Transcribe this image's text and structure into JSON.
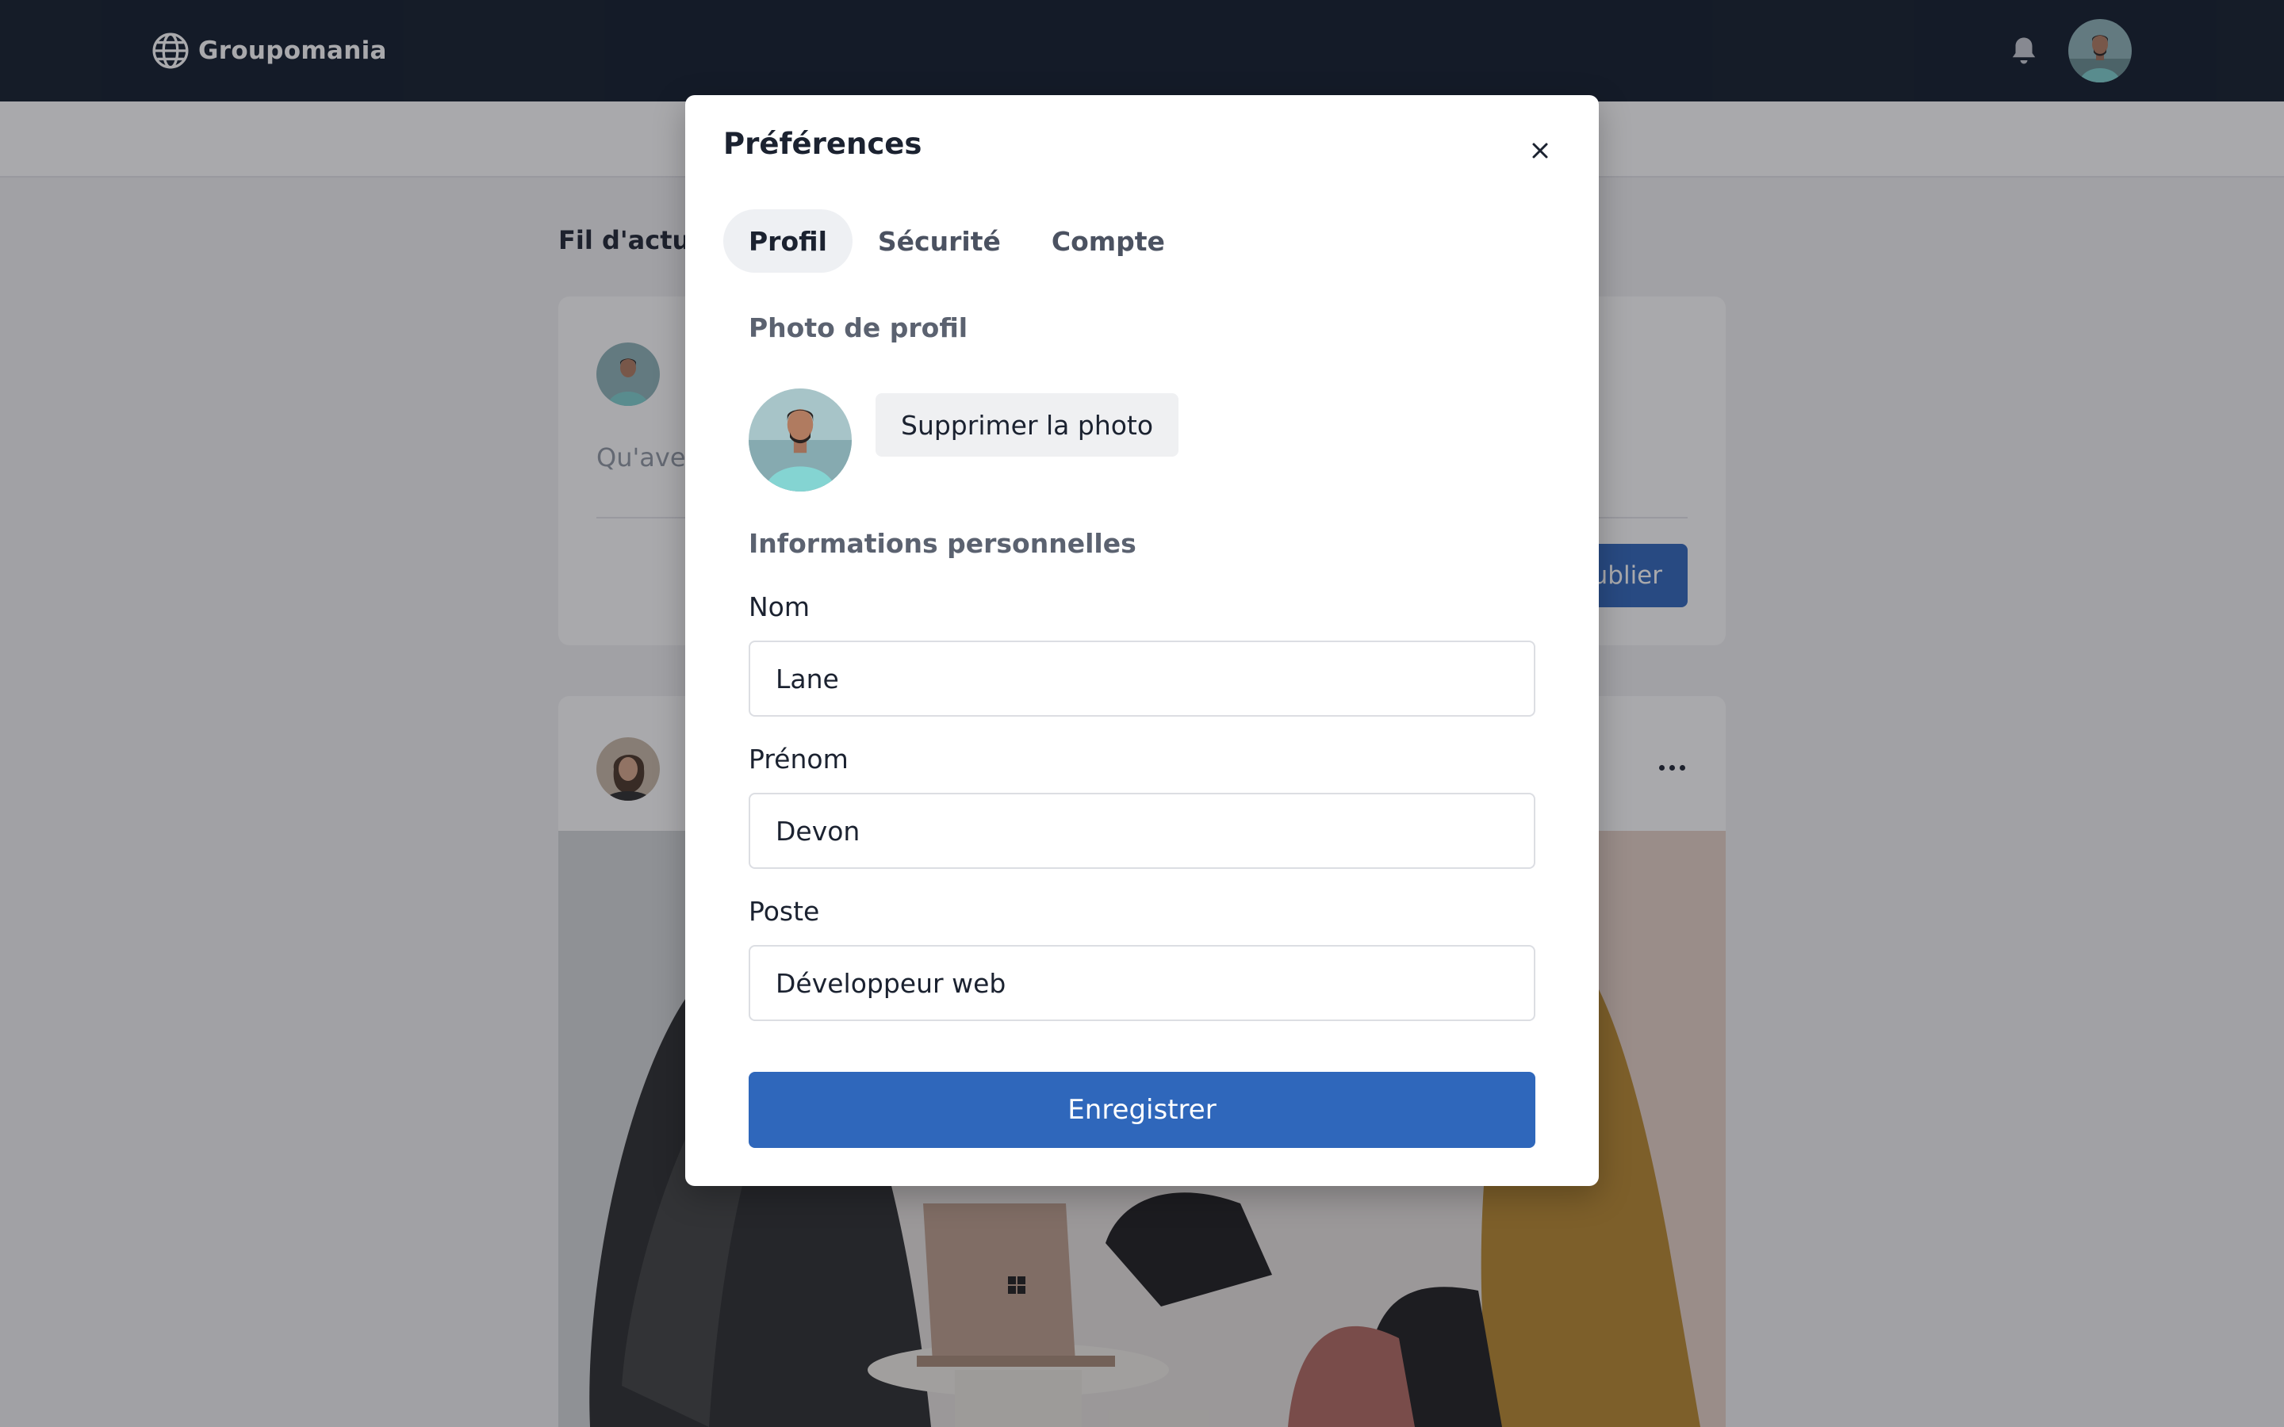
{
  "navbar": {
    "brand_name": "Groupomania",
    "brand_icon": "globe-icon",
    "notifications_icon": "bell-icon"
  },
  "feed": {
    "title": "Fil d'actua",
    "composer_placeholder": "Qu'ave",
    "publish_label": "ublier",
    "more_icon": "more-horizontal-icon"
  },
  "modal": {
    "title": "Préférences",
    "close_icon": "close-icon",
    "tabs": [
      {
        "label": "Profil",
        "active": true
      },
      {
        "label": "Sécurité",
        "active": false
      },
      {
        "label": "Compte",
        "active": false
      }
    ],
    "photo_section_label": "Photo de profil",
    "delete_photo_label": "Supprimer la photo",
    "personal_info_label": "Informations personnelles",
    "fields": {
      "last_name": {
        "label": "Nom",
        "value": "Lane"
      },
      "first_name": {
        "label": "Prénom",
        "value": "Devon"
      },
      "position": {
        "label": "Poste",
        "value": "Développeur web"
      }
    },
    "save_label": "Enregistrer"
  },
  "colors": {
    "navbar_bg": "#0f1a2b",
    "primary": "#2f67bb",
    "overlay": "rgba(30,30,36,0.38)"
  }
}
